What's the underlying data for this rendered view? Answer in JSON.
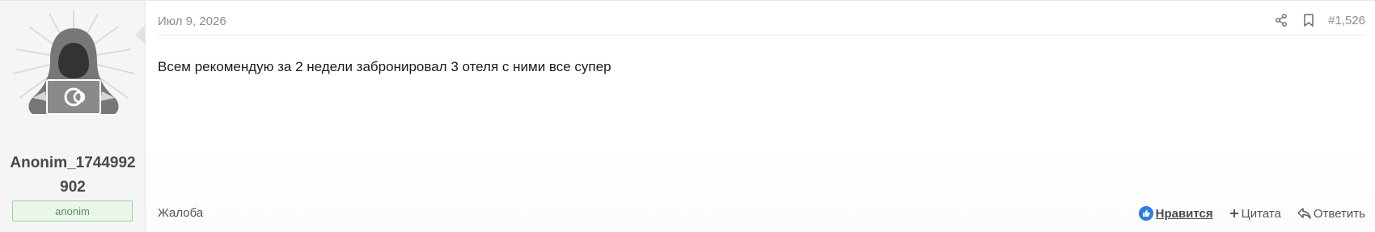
{
  "user": {
    "name": "Anonim_1744992902",
    "title": "anonim",
    "avatar_icon": "hooded-hacker-avatar"
  },
  "post": {
    "date": "Июл 9, 2026",
    "number": "#1,526",
    "body": "Всем рекомендую за 2 недели забронировал 3 отеля с ними все супер",
    "share_icon": "share-icon",
    "bookmark_icon": "bookmark-icon"
  },
  "footer": {
    "report": "Жалоба",
    "like": "Нравится",
    "quote": "Цитата",
    "reply": "Ответить"
  },
  "colors": {
    "like_icon": "#2b7de1",
    "usertitle_border": "#9cd29c",
    "usertitle_bg": "#eaf6ea"
  }
}
